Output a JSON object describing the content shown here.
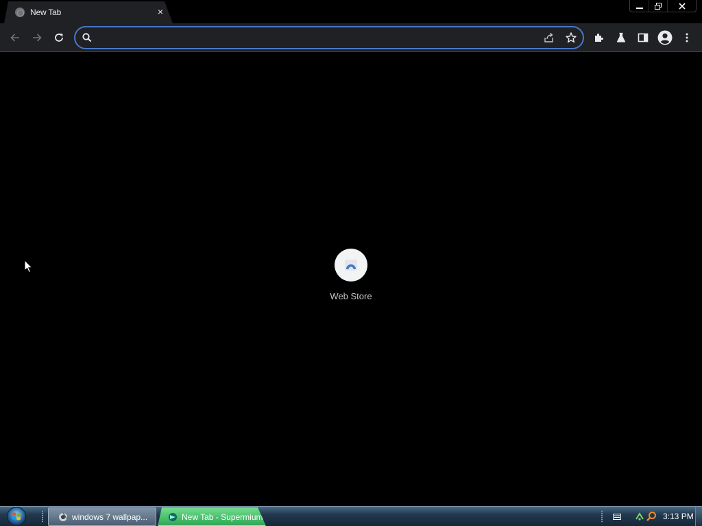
{
  "window": {
    "tab_title": "New Tab",
    "tab_close": "×",
    "controls": {
      "minimize": "—",
      "restore": "❐",
      "close": "✕"
    }
  },
  "toolbar": {
    "omnibox_value": "",
    "omnibox_placeholder": "",
    "icons": [
      "back-icon",
      "forward-icon",
      "reload-icon",
      "search-icon",
      "share-icon",
      "star-icon",
      "extensions-icon",
      "labs-icon",
      "side-panel-icon",
      "profile-icon",
      "menu-icon"
    ]
  },
  "content": {
    "shortcuts": [
      {
        "label": "Web Store"
      }
    ]
  },
  "taskbar": {
    "buttons": [
      {
        "label": "windows 7 wallpap..."
      },
      {
        "label": "New Tab - Supermium"
      }
    ],
    "clock": "3:13 PM"
  },
  "colors": {
    "accent": "#4a77c9",
    "toolbar": "#202124",
    "active_task": "#2fa856"
  }
}
